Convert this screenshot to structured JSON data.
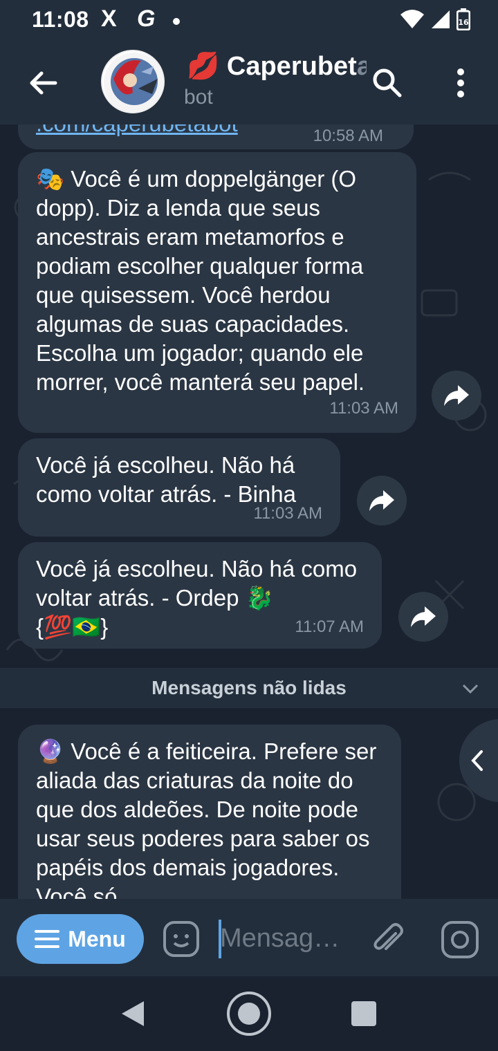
{
  "status_bar": {
    "time": "11:08",
    "x_icon": "X",
    "g_icon": "G",
    "battery": "16"
  },
  "header": {
    "title_visible": "Caperubet",
    "title_faded": "a",
    "subtitle": "bot"
  },
  "messages": [
    {
      "type": "partial",
      "link_text": ".com/caperubetabot",
      "time": "10:58 AM"
    },
    {
      "emoji": "🎭",
      "text": "Você é um doppelgänger (O dopp). Diz a lenda que seus ancestrais eram metamorfos e podiam escolher qualquer forma que quisessem. Você herdou algumas de suas capacidades. Escolha um jogador; quando ele morrer, você manterá seu papel.",
      "time": "11:03 AM"
    },
    {
      "text": "Você já escolheu. Não há como voltar atrás. - Binha",
      "time": "11:03 AM"
    },
    {
      "text": "Você já escolheu. Não há como voltar atrás. - Ordep 🐉",
      "text_line3": "{💯🇧🇷}",
      "time": "11:07 AM"
    },
    {
      "emoji": "🔮",
      "text": "Você é a feiticeira. Prefere ser aliada das criaturas da noite do que dos aldeões. De noite pode usar seus poderes para saber os papéis dos demais jogadores. Você só"
    }
  ],
  "unread_divider": "Mensagens não lidas",
  "input": {
    "menu_label": "Menu",
    "placeholder": "Mensag…"
  },
  "colors": {
    "background": "#1a2230",
    "header": "#232e3c",
    "bubble": "#2b3644",
    "accent": "#5ea4e4",
    "link": "#6fb6f3"
  }
}
